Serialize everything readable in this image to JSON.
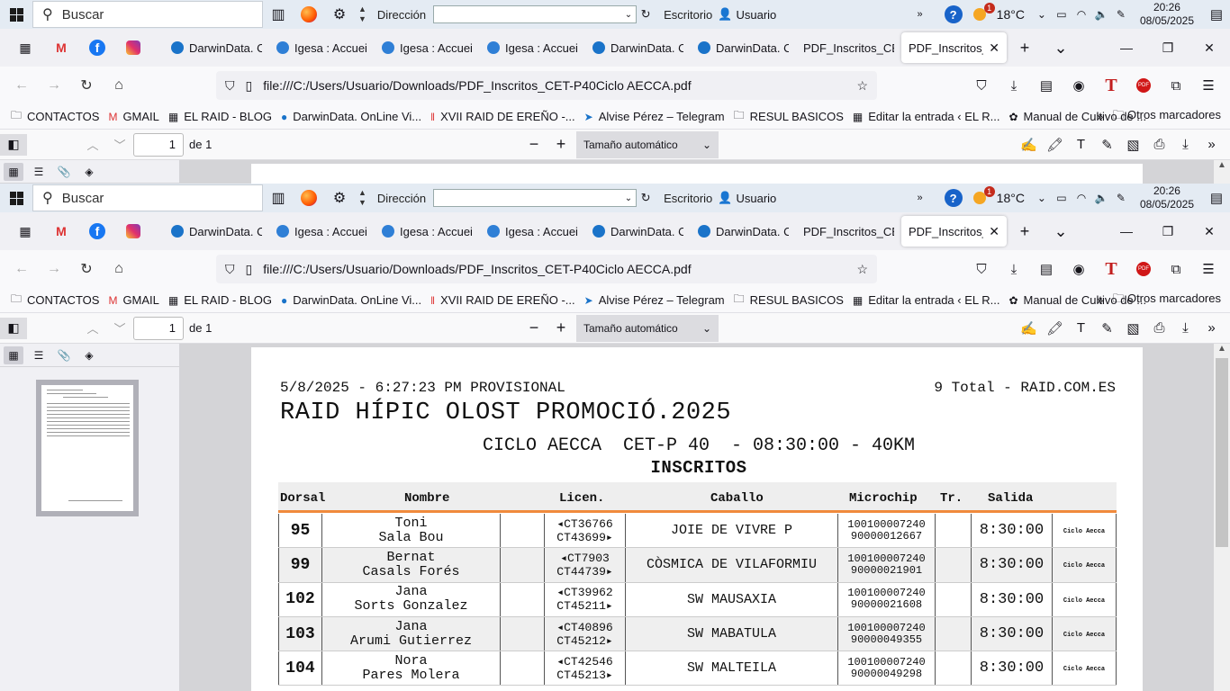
{
  "taskbar": {
    "search_placeholder": "Buscar",
    "address_label": "Dirección",
    "desktop_label": "Escritorio",
    "user_label": "Usuario",
    "temperature": "18°C",
    "weather_badge": "1",
    "time": "20:26",
    "date": "08/05/2025"
  },
  "tabs": [
    {
      "label": "DarwinData. C",
      "icon": "darwin-icon",
      "color": "#1a73c9"
    },
    {
      "label": "Igesa : Accueil",
      "icon": "igesa-icon",
      "color": "#2f7fd6"
    },
    {
      "label": "Igesa : Accueil",
      "icon": "igesa-icon",
      "color": "#2f7fd6"
    },
    {
      "label": "Igesa : Accueil",
      "icon": "igesa-icon",
      "color": "#2f7fd6"
    },
    {
      "label": "DarwinData. C",
      "icon": "darwin-icon",
      "color": "#1a73c9"
    },
    {
      "label": "DarwinData. C",
      "icon": "darwin-icon",
      "color": "#1a73c9"
    },
    {
      "label": "PDF_Inscritos_CET",
      "icon": "",
      "color": ""
    },
    {
      "label": "PDF_Inscritos_C",
      "icon": "",
      "color": "",
      "active": true
    }
  ],
  "nav": {
    "url": "file:///C:/Users/Usuario/Downloads/PDF_Inscritos_CET-P40Ciclo AECCA.pdf"
  },
  "bookmarks": [
    {
      "label": "CONTACTOS",
      "icon": "folder-icon"
    },
    {
      "label": "GMAIL",
      "icon": "gmail-icon"
    },
    {
      "label": "EL RAID - BLOG",
      "icon": "raid-icon"
    },
    {
      "label": "DarwinData. OnLine Vi...",
      "icon": "darwin-icon"
    },
    {
      "label": "XVII RAID DE EREÑO -...",
      "icon": "flag-icon"
    },
    {
      "label": "Alvise Pérez – Telegram",
      "icon": "telegram-icon"
    },
    {
      "label": "RESUL BASICOS",
      "icon": "folder-icon"
    },
    {
      "label": "Editar la entrada ‹ EL R...",
      "icon": "raid-icon"
    },
    {
      "label": "Manual de Cultivo de ...",
      "icon": "plant-icon"
    }
  ],
  "bookmarks_other": "Otros marcadores",
  "pdf_toolbar": {
    "page_value": "1",
    "page_total": "de 1",
    "zoom_label": "Tamaño automático"
  },
  "document": {
    "header_left": "5/8/2025 - 6:27:23 PM PROVISIONAL",
    "header_right": "9 Total - RAID.COM.ES",
    "title": "RAID HÍPIC OLOST PROMOCIÓ.2025",
    "subtitle": "CICLO AECCA  CET-P 40  - 08:30:00 - 40KM",
    "subtitle2": "INSCRITOS",
    "columns": [
      "Dorsal",
      "Nombre",
      "Licen.",
      "Caballo",
      "Microchip",
      "Tr.",
      "Salida"
    ],
    "rows": [
      {
        "dorsal": "95",
        "name1": "Toni",
        "name2": "Sala Bou",
        "lic1": "◂CT36766",
        "lic2": "CT43699▸",
        "horse": "JOIE DE VIVRE P",
        "chip1": "100100007240",
        "chip2": "90000012667",
        "salida": "8:30:00",
        "ciclo": "Ciclo Aecca"
      },
      {
        "dorsal": "99",
        "name1": "Bernat",
        "name2": "Casals Forés",
        "lic1": "◂CT7903",
        "lic2": "CT44739▸",
        "horse": "CÒSMICA DE VILAFORMIU",
        "chip1": "100100007240",
        "chip2": "90000021901",
        "salida": "8:30:00",
        "ciclo": "Ciclo Aecca"
      },
      {
        "dorsal": "102",
        "name1": "Jana",
        "name2": "Sorts Gonzalez",
        "lic1": "◂CT39962",
        "lic2": "CT45211▸",
        "horse": "SW MAUSAXIA",
        "chip1": "100100007240",
        "chip2": "90000021608",
        "salida": "8:30:00",
        "ciclo": "Ciclo Aecca"
      },
      {
        "dorsal": "103",
        "name1": "Jana",
        "name2": "Arumi Gutierrez",
        "lic1": "◂CT40896",
        "lic2": "CT45212▸",
        "horse": "SW MABATULA",
        "chip1": "100100007240",
        "chip2": "90000049355",
        "salida": "8:30:00",
        "ciclo": "Ciclo Aecca"
      },
      {
        "dorsal": "104",
        "name1": "Nora",
        "name2": "Pares Molera",
        "lic1": "◂CT42546",
        "lic2": "CT45213▸",
        "horse": "SW MALTEILA",
        "chip1": "100100007240",
        "chip2": "90000049298",
        "salida": "8:30:00",
        "ciclo": "Ciclo Aecca"
      }
    ]
  }
}
